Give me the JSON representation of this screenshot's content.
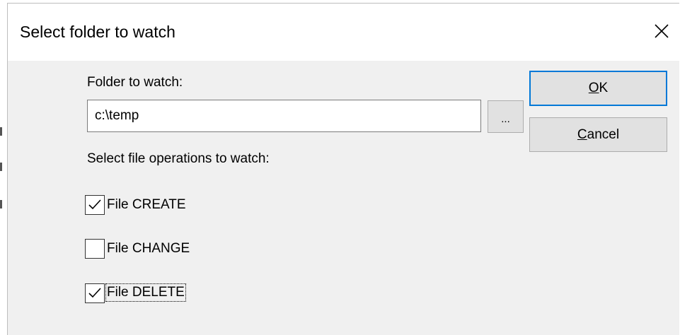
{
  "dialog": {
    "title": "Select folder to watch",
    "close_icon": "close-icon"
  },
  "folder": {
    "label": "Folder to watch:",
    "value": "c:\\temp",
    "browse_label": "..."
  },
  "buttons": {
    "ok_label": "OK",
    "cancel_label": "Cancel",
    "ok_is_default": true
  },
  "operations": {
    "label": "Select file operations to watch:",
    "items": [
      {
        "label": "File CREATE",
        "checked": true
      },
      {
        "label": "File CHANGE",
        "checked": false
      },
      {
        "label": "File DELETE",
        "checked": true,
        "focused": true
      }
    ]
  },
  "colors": {
    "dialog_bg": "#f0f0f0",
    "title_bg": "#ffffff",
    "button_bg": "#e1e1e1",
    "default_button_border": "#0078d7"
  }
}
